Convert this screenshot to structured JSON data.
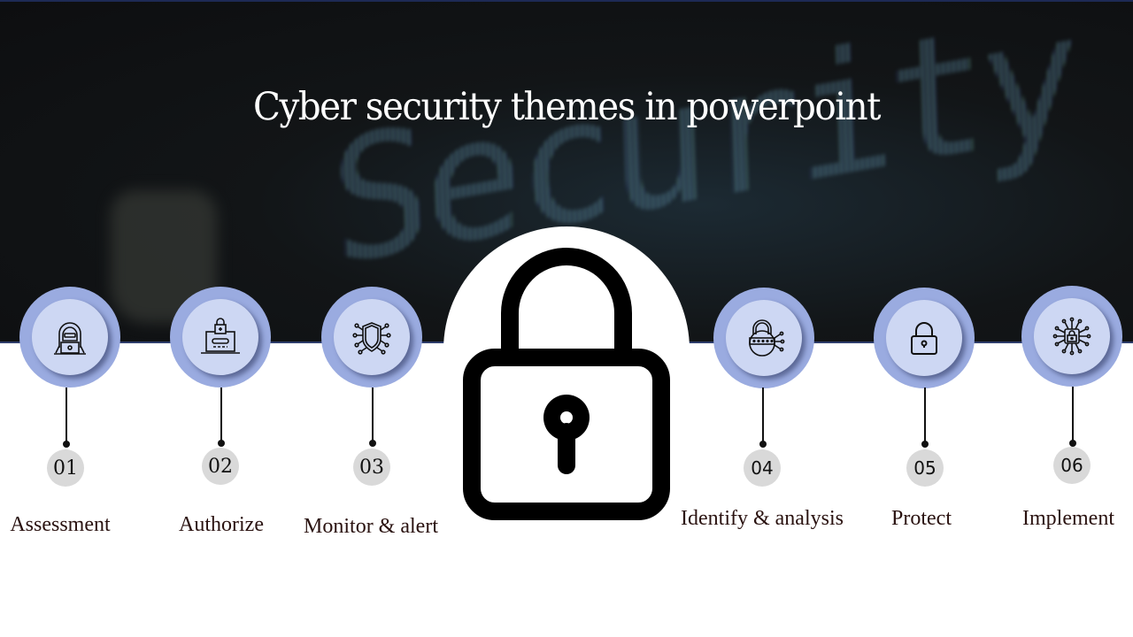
{
  "slide": {
    "title": "Cyber security themes in powerpoint",
    "background_word": "Security",
    "colors": {
      "ring": "#9aabe0",
      "inner": "#cdd7f3",
      "number_badge": "#d9d9d9",
      "label_text": "#2a1210",
      "hero_bg": "#121517"
    },
    "center_icon": "padlock-icon",
    "steps": [
      {
        "number": "01",
        "label": "Assessment",
        "icon": "hacker-laptop-icon"
      },
      {
        "number": "02",
        "label": "Authorize",
        "icon": "laptop-lock-icon"
      },
      {
        "number": "03",
        "label": "Monitor & alert",
        "icon": "shield-circuit-icon"
      },
      {
        "number": "04",
        "label": "Identify & analysis",
        "icon": "password-lock-circuit-icon"
      },
      {
        "number": "05",
        "label": "Protect",
        "icon": "padlock-icon"
      },
      {
        "number": "06",
        "label": "Implement",
        "icon": "chip-lock-icon"
      }
    ]
  }
}
